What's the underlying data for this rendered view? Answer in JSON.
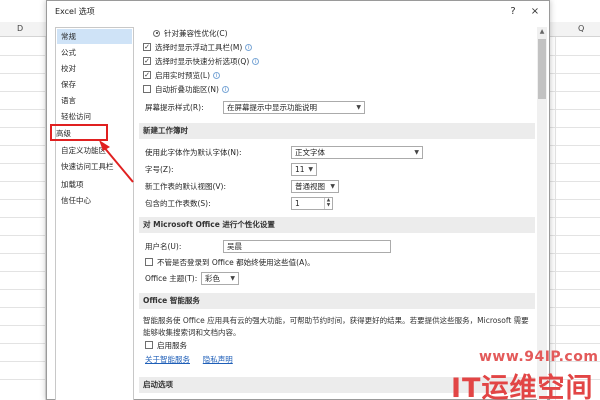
{
  "sheet": {
    "columns": [
      "D",
      "Q"
    ]
  },
  "dialog": {
    "title": "Excel 选项",
    "help_glyph": "?",
    "close_glyph": "×"
  },
  "nav": {
    "items": [
      {
        "label": "常规"
      },
      {
        "label": "公式"
      },
      {
        "label": "校对"
      },
      {
        "label": "保存"
      },
      {
        "label": "语言"
      },
      {
        "label": "轻松访问"
      },
      {
        "label": "高级"
      },
      {
        "label": "自定义功能区"
      },
      {
        "label": "快速访问工具栏"
      },
      {
        "label": "加载项"
      },
      {
        "label": "信任中心"
      }
    ],
    "selected_index": 0,
    "highlighted_index": 6
  },
  "ui_options": {
    "compat_radio": "针对兼容性优化(C)",
    "mini_toolbar": "选择时显示浮动工具栏(M)",
    "quick_analysis": "选择时显示快速分析选项(Q)",
    "live_preview": "启用实时预览(L)",
    "collapse_ribbon": "自动折叠功能区(N)",
    "screentip_label": "屏幕提示样式(R):",
    "screentip_value": "在屏幕提示中显示功能说明"
  },
  "new_workbook": {
    "header": "新建工作簿时",
    "font_label": "使用此字体作为默认字体(N):",
    "font_value": "正文字体",
    "size_label": "字号(Z):",
    "size_value": "11",
    "view_label": "新工作表的默认视图(V):",
    "view_value": "普通视图",
    "sheets_label": "包含的工作表数(S):",
    "sheets_value": "1"
  },
  "personalize": {
    "header": "对 Microsoft Office 进行个性化设置",
    "username_label": "用户名(U):",
    "username_value": "吴晨",
    "always_use": "不管是否登录到 Office 都始终使用这些值(A)。",
    "theme_label": "Office 主题(T):",
    "theme_value": "彩色"
  },
  "intelligent": {
    "header": "Office 智能服务",
    "description": "智能服务使 Office 应用具有云的强大功能，可帮助节约时间，获得更好的结果。若要提供这些服务，Microsoft 需要能够收集搜索词和文档内容。",
    "enable": "启用服务",
    "about_link": "关于智能服务",
    "privacy_link": "隐私声明"
  },
  "next_section": {
    "header": "启动选项"
  },
  "watermark": {
    "url": "www.94IP.com",
    "text": "IT运维空间"
  },
  "colors": {
    "selected_nav": "#cfe3f7",
    "highlight": "#e02020",
    "link": "#1f5fb8"
  }
}
